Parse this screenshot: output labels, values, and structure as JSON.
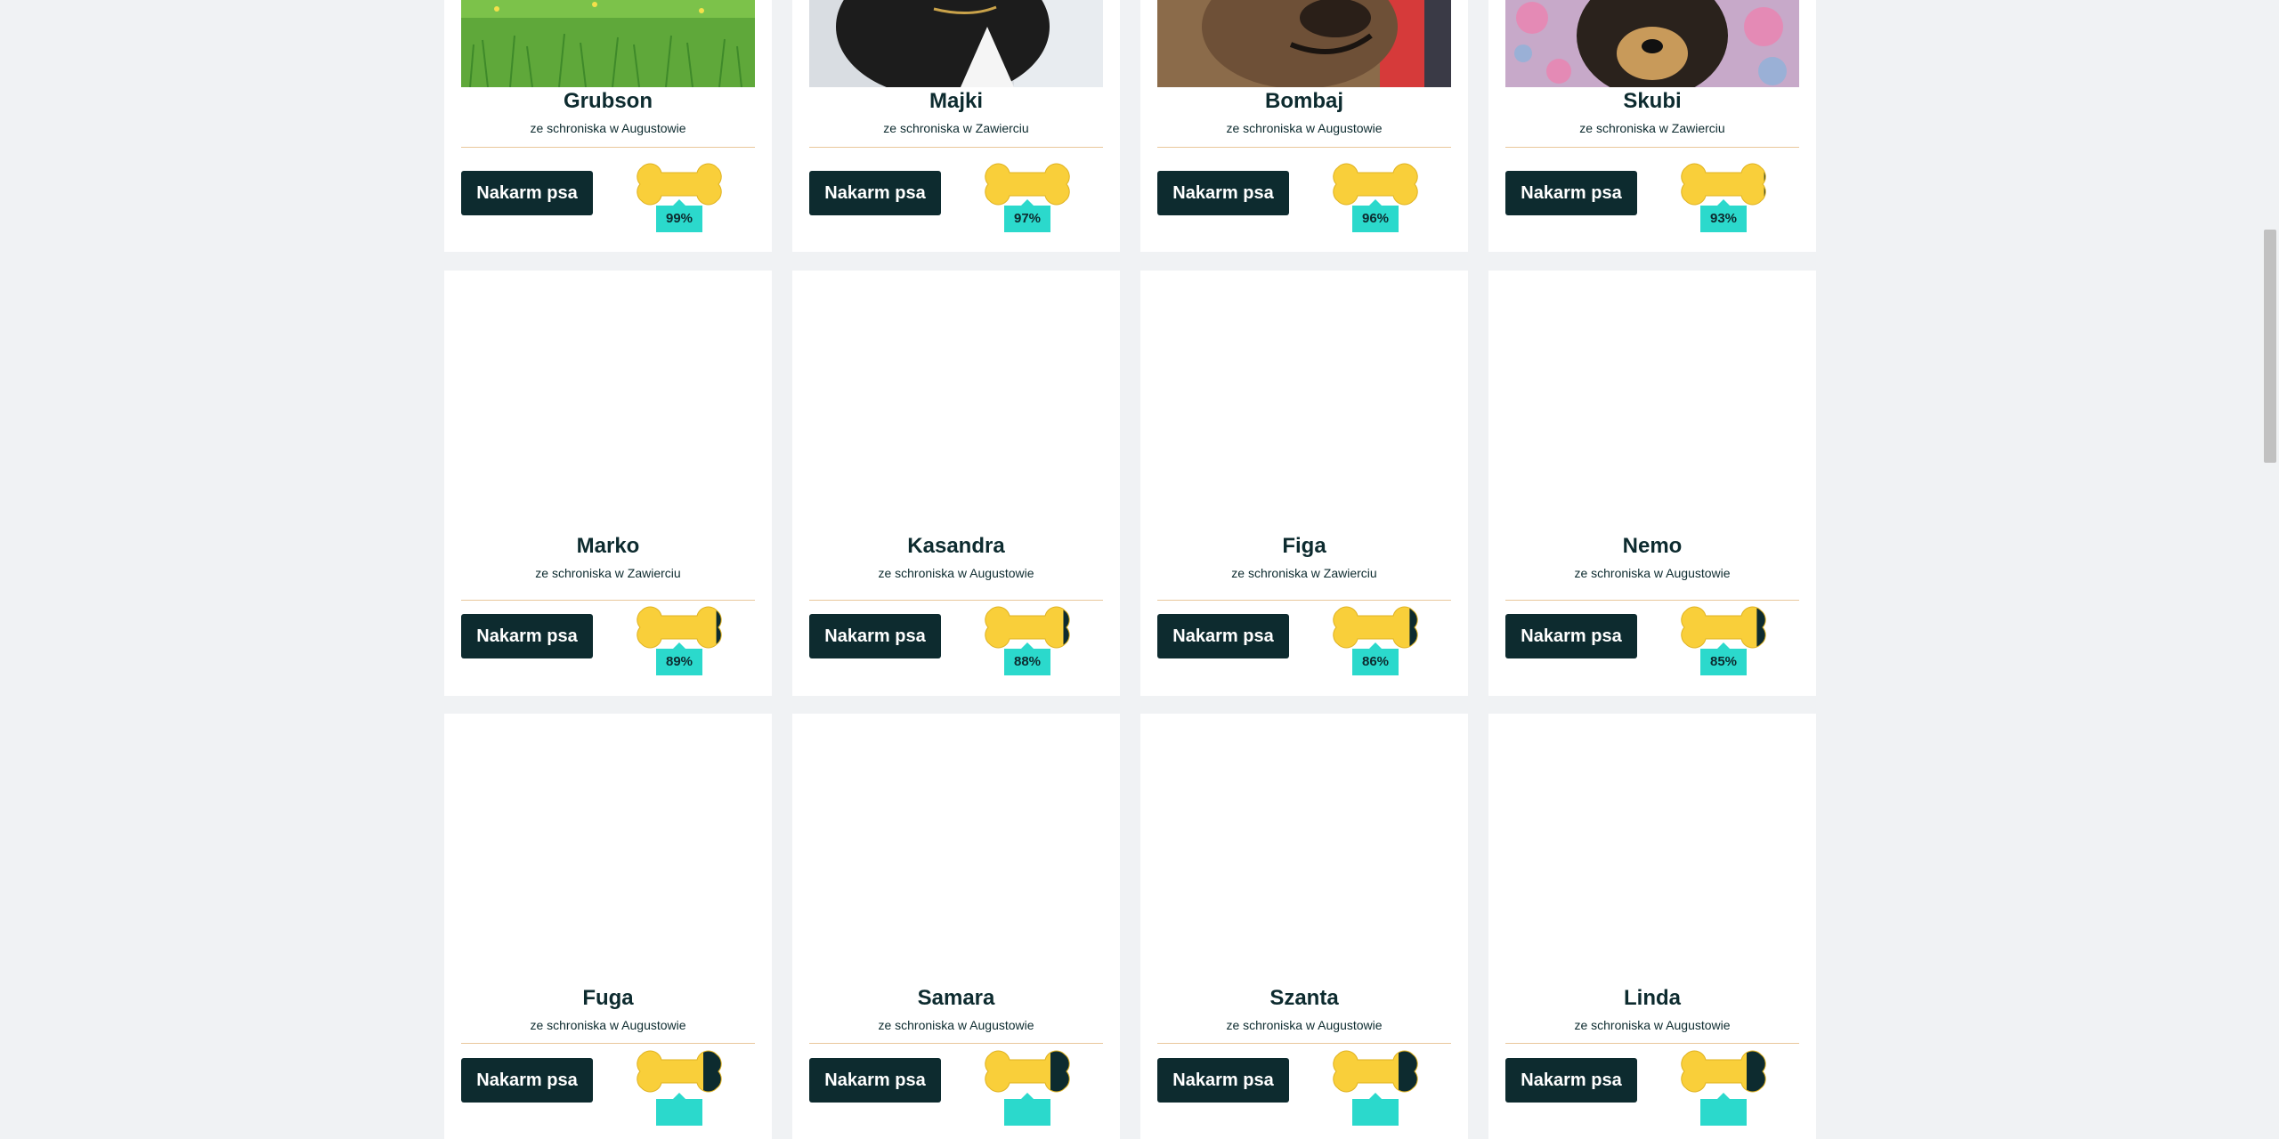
{
  "feed_label": "Nakarm psa",
  "colors": {
    "bone": "#f9cf3a",
    "bone_empty": "#0d2b2f",
    "badge": "#2bd9cc",
    "button": "#0d2b2f",
    "divider": "#e9c79b"
  },
  "dogs": [
    {
      "name": "Grubson",
      "shelter": "ze schroniska w Augustowie",
      "percent_label": "99%",
      "fill": 0.99,
      "photo": "dog-photo-grass"
    },
    {
      "name": "Majki",
      "shelter": "ze schroniska w Zawierciu",
      "percent_label": "97%",
      "fill": 0.97,
      "photo": "dog-photo-black-white"
    },
    {
      "name": "Bombaj",
      "shelter": "ze schroniska w Augustowie",
      "percent_label": "96%",
      "fill": 0.96,
      "photo": "dog-photo-brindle"
    },
    {
      "name": "Skubi",
      "shelter": "ze schroniska w Zawierciu",
      "percent_label": "93%",
      "fill": 0.93,
      "photo": "dog-photo-flowers"
    },
    {
      "name": "Marko",
      "shelter": "ze schroniska w Zawierciu",
      "percent_label": "89%",
      "fill": 0.89
    },
    {
      "name": "Kasandra",
      "shelter": "ze schroniska w Augustowie",
      "percent_label": "88%",
      "fill": 0.88
    },
    {
      "name": "Figa",
      "shelter": "ze schroniska w Zawierciu",
      "percent_label": "86%",
      "fill": 0.86
    },
    {
      "name": "Nemo",
      "shelter": "ze schroniska w Augustowie",
      "percent_label": "85%",
      "fill": 0.85
    },
    {
      "name": "Fuga",
      "shelter": "ze schroniska w Augustowie",
      "fill": 0.75
    },
    {
      "name": "Samara",
      "shelter": "ze schroniska w Augustowie",
      "fill": 0.74
    },
    {
      "name": "Szanta",
      "shelter": "ze schroniska w Augustowie",
      "fill": 0.74
    },
    {
      "name": "Linda",
      "shelter": "ze schroniska w Augustowie",
      "fill": 0.74
    }
  ]
}
